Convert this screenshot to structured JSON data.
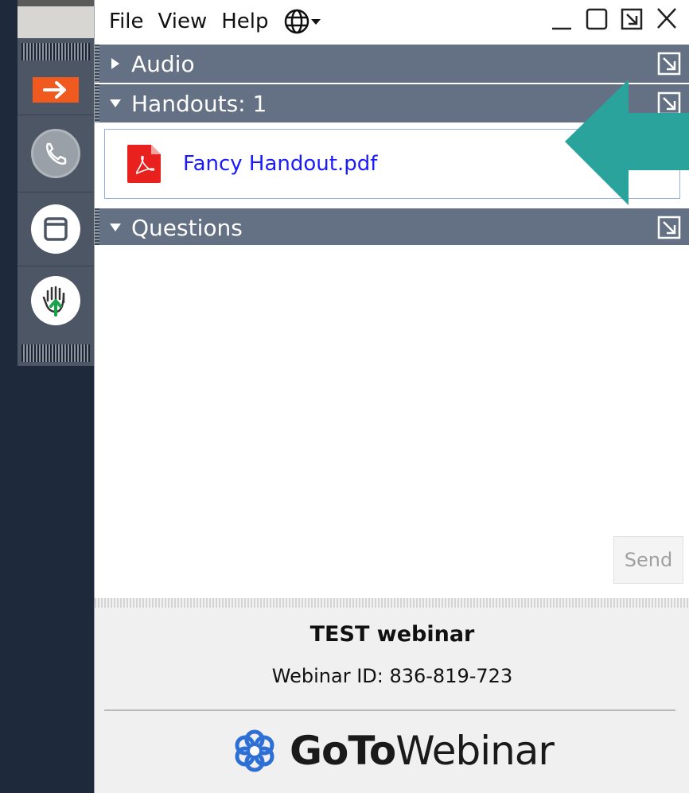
{
  "menu": {
    "file": "File",
    "view": "View",
    "help": "Help"
  },
  "sections": {
    "audio": "Audio",
    "handouts": "Handouts: 1",
    "questions": "Questions"
  },
  "handout": {
    "filename": "Fancy Handout.pdf"
  },
  "send_label": "Send",
  "footer": {
    "title": "TEST webinar",
    "webinar_id": "Webinar ID: 836-819-723",
    "brand_bold": "GoTo",
    "brand_light": "Webinar"
  },
  "colors": {
    "section_header": "#647083",
    "sidebar": "#4c5664",
    "accent_orange": "#f05a1e",
    "teal_arrow": "#2aa39c",
    "link_blue": "#1a1aff"
  }
}
